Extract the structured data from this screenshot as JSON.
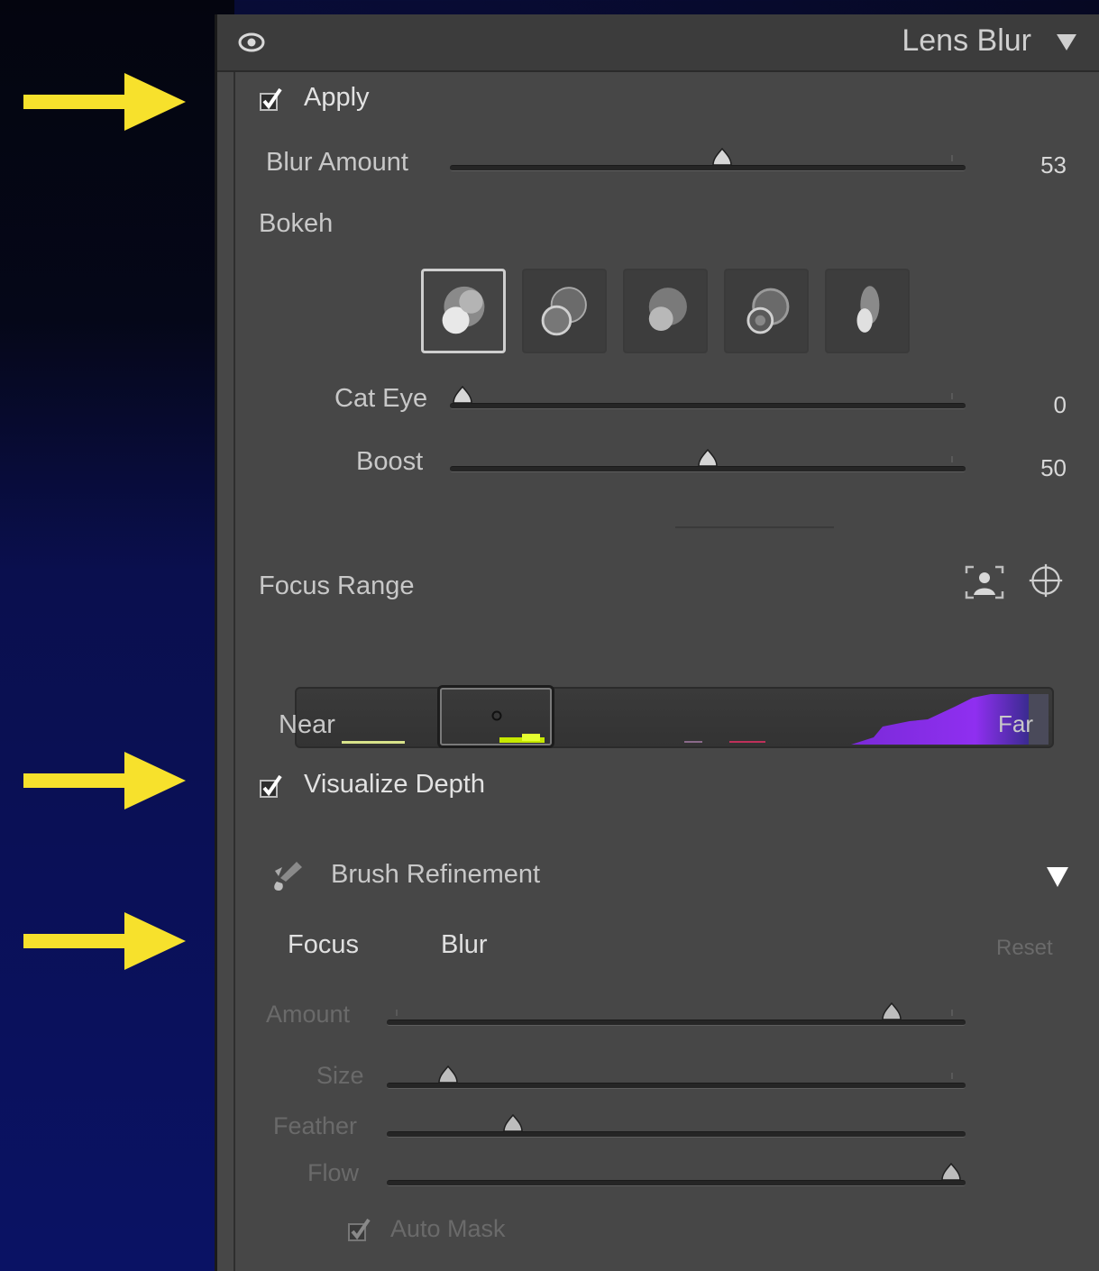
{
  "header": {
    "title": "Lens Blur"
  },
  "apply": {
    "label": "Apply",
    "checked": true
  },
  "blur_amount": {
    "label": "Blur Amount",
    "value": "53"
  },
  "bokeh": {
    "label": "Bokeh",
    "shapes": [
      "bokeh-circle",
      "bokeh-bubble",
      "bokeh-blade",
      "bokeh-ring",
      "bokeh-cat-eye"
    ],
    "selected_index": 0
  },
  "cat_eye": {
    "label": "Cat Eye",
    "value": "0"
  },
  "boost": {
    "label": "Boost",
    "value": "50"
  },
  "focus_range": {
    "label": "Focus Range",
    "near_label": "Near",
    "far_label": "Far",
    "icons": [
      "subject-focus-icon",
      "point-focus-icon"
    ]
  },
  "visualize_depth": {
    "label": "Visualize Depth",
    "checked": true
  },
  "brush_refinement": {
    "label": "Brush Refinement",
    "tabs": {
      "focus": "Focus",
      "blur": "Blur"
    },
    "reset_label": "Reset",
    "sliders": [
      {
        "label": "Amount",
        "value": ""
      },
      {
        "label": "Size",
        "value": ""
      },
      {
        "label": "Feather",
        "value": ""
      },
      {
        "label": "Flow",
        "value": ""
      }
    ],
    "auto_mask": {
      "label": "Auto Mask",
      "checked": true
    }
  },
  "colors": {
    "accent_arrow": "#f7e12c",
    "panel": "#474747",
    "depth_purple": "#8a2be2"
  }
}
